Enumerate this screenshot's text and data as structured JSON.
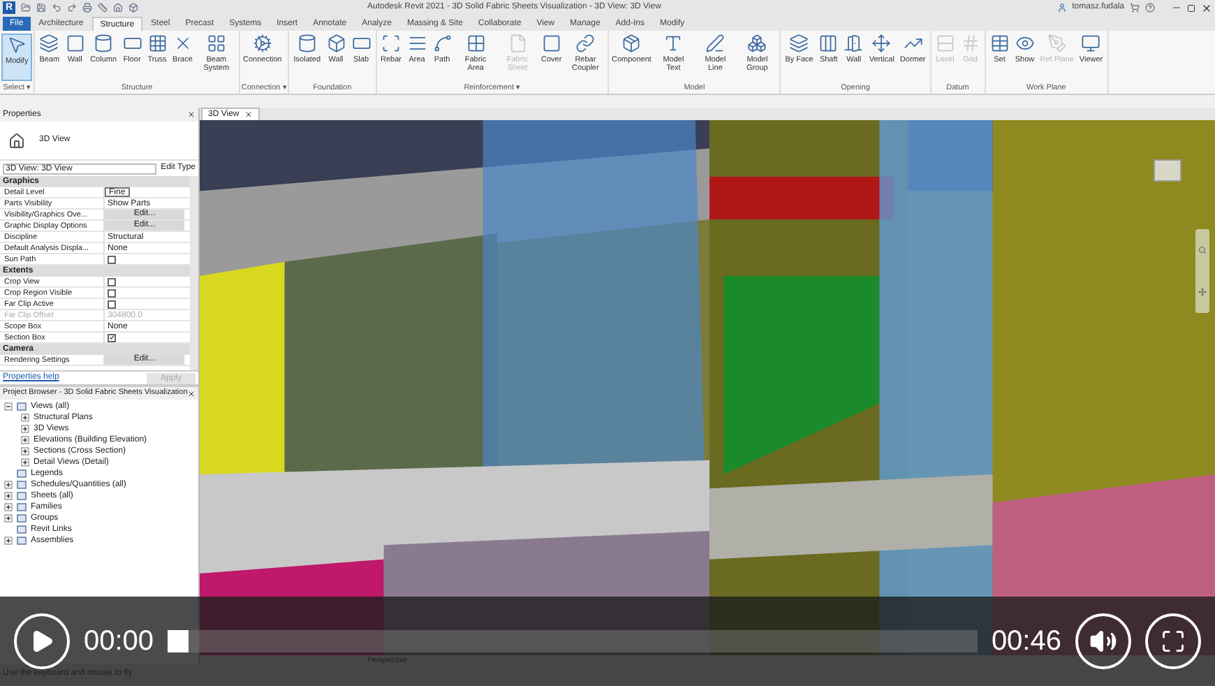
{
  "title_bar": {
    "app_logo": "R",
    "title": "Autodesk Revit 2021 - 3D Solid Fabric Sheets Visualization - 3D View: 3D View",
    "user": "tomasz.fudala"
  },
  "ribbon_tabs": [
    {
      "label": "File",
      "selected": false,
      "kind": "file"
    },
    {
      "label": "Architecture",
      "selected": false,
      "kind": "tab"
    },
    {
      "label": "Structure",
      "selected": true,
      "kind": "tab"
    },
    {
      "label": "Steel",
      "selected": false,
      "kind": "tab"
    },
    {
      "label": "Precast",
      "selected": false,
      "kind": "tab"
    },
    {
      "label": "Systems",
      "selected": false,
      "kind": "tab"
    },
    {
      "label": "Insert",
      "selected": false,
      "kind": "tab"
    },
    {
      "label": "Annotate",
      "selected": false,
      "kind": "tab"
    },
    {
      "label": "Analyze",
      "selected": false,
      "kind": "tab"
    },
    {
      "label": "Massing & Site",
      "selected": false,
      "kind": "tab"
    },
    {
      "label": "Collaborate",
      "selected": false,
      "kind": "tab"
    },
    {
      "label": "View",
      "selected": false,
      "kind": "tab"
    },
    {
      "label": "Manage",
      "selected": false,
      "kind": "tab"
    },
    {
      "label": "Add-Ins",
      "selected": false,
      "kind": "tab"
    },
    {
      "label": "Modify",
      "selected": false,
      "kind": "tab"
    }
  ],
  "ribbon_panels": [
    {
      "title": "Select ▾",
      "tools": [
        {
          "label": "Modify",
          "active": true,
          "disabled": false
        }
      ]
    },
    {
      "title": "Structure",
      "tools": [
        {
          "label": "Beam",
          "active": false,
          "disabled": false
        },
        {
          "label": "Wall",
          "active": false,
          "disabled": false
        },
        {
          "label": "Column",
          "active": false,
          "disabled": false
        },
        {
          "label": "Floor",
          "active": false,
          "disabled": false
        },
        {
          "label": "Truss",
          "active": false,
          "disabled": false
        },
        {
          "label": "Brace",
          "active": false,
          "disabled": false
        },
        {
          "label": "Beam System",
          "active": false,
          "disabled": false
        }
      ]
    },
    {
      "title": "Connection ▾",
      "tools": [
        {
          "label": "Connection",
          "active": false,
          "disabled": false
        }
      ]
    },
    {
      "title": "Foundation",
      "tools": [
        {
          "label": "Isolated",
          "active": false,
          "disabled": false
        },
        {
          "label": "Wall",
          "active": false,
          "disabled": false
        },
        {
          "label": "Slab",
          "active": false,
          "disabled": false
        }
      ]
    },
    {
      "title": "Reinforcement ▾",
      "tools": [
        {
          "label": "Rebar",
          "active": false,
          "disabled": false
        },
        {
          "label": "Area",
          "active": false,
          "disabled": false
        },
        {
          "label": "Path",
          "active": false,
          "disabled": false
        },
        {
          "label": "Fabric Area",
          "active": false,
          "disabled": false
        },
        {
          "label": "Fabric Sheet",
          "active": false,
          "disabled": true
        },
        {
          "label": "Cover",
          "active": false,
          "disabled": false
        },
        {
          "label": "Rebar Coupler",
          "active": false,
          "disabled": false
        }
      ]
    },
    {
      "title": "Model",
      "tools": [
        {
          "label": "Component",
          "active": false,
          "disabled": false
        },
        {
          "label": "Model Text",
          "active": false,
          "disabled": false
        },
        {
          "label": "Model Line",
          "active": false,
          "disabled": false
        },
        {
          "label": "Model Group",
          "active": false,
          "disabled": false
        }
      ]
    },
    {
      "title": "Opening",
      "tools": [
        {
          "label": "By Face",
          "active": false,
          "disabled": false
        },
        {
          "label": "Shaft",
          "active": false,
          "disabled": false
        },
        {
          "label": "Wall",
          "active": false,
          "disabled": false
        },
        {
          "label": "Vertical",
          "active": false,
          "disabled": false
        },
        {
          "label": "Dormer",
          "active": false,
          "disabled": false
        }
      ]
    },
    {
      "title": "Datum",
      "tools": [
        {
          "label": "Level",
          "active": false,
          "disabled": true
        },
        {
          "label": "Grid",
          "active": false,
          "disabled": true
        }
      ]
    },
    {
      "title": "Work Plane",
      "tools": [
        {
          "label": "Set",
          "active": false,
          "disabled": false
        },
        {
          "label": "Show",
          "active": false,
          "disabled": false
        },
        {
          "label": "Ref Plane",
          "active": false,
          "disabled": true
        },
        {
          "label": "Viewer",
          "active": false,
          "disabled": false
        }
      ]
    }
  ],
  "properties": {
    "title": "Properties",
    "type_name": "3D View",
    "selector": "3D View: 3D View",
    "edit_type": "Edit Type",
    "sections": [
      {
        "title": "Graphics",
        "rows": [
          {
            "label": "Detail Level",
            "kind": "field",
            "value": "Fine"
          },
          {
            "label": "Parts Visibility",
            "kind": "text",
            "value": "Show Parts"
          },
          {
            "label": "Visibility/Graphics Ove...",
            "kind": "button",
            "value": "Edit..."
          },
          {
            "label": "Graphic Display Options",
            "kind": "button",
            "value": "Edit..."
          },
          {
            "label": "Discipline",
            "kind": "text",
            "value": "Structural"
          },
          {
            "label": "Default Analysis Displa...",
            "kind": "text",
            "value": "None"
          },
          {
            "label": "Sun Path",
            "kind": "checkbox",
            "checked": false
          }
        ]
      },
      {
        "title": "Extents",
        "rows": [
          {
            "label": "Crop View",
            "kind": "checkbox",
            "checked": false
          },
          {
            "label": "Crop Region Visible",
            "kind": "checkbox",
            "checked": false
          },
          {
            "label": "Far Clip Active",
            "kind": "checkbox",
            "checked": false
          },
          {
            "label": "Far Clip Offset",
            "kind": "disabled",
            "value": "304800.0"
          },
          {
            "label": "Scope Box",
            "kind": "text",
            "value": "None"
          },
          {
            "label": "Section Box",
            "kind": "checkbox",
            "checked": true
          }
        ]
      },
      {
        "title": "Camera",
        "rows": [
          {
            "label": "Rendering Settings",
            "kind": "button",
            "value": "Edit..."
          }
        ]
      }
    ],
    "help_link": "Properties help",
    "apply": "Apply"
  },
  "project_browser": {
    "title": "Project Browser - 3D Solid Fabric Sheets Visualization",
    "items": [
      {
        "label": "Views (all)",
        "expanded": true,
        "children": [
          {
            "label": "Structural Plans",
            "expanded": false
          },
          {
            "label": "3D Views",
            "expanded": false
          },
          {
            "label": "Elevations (Building Elevation)",
            "expanded": false
          },
          {
            "label": "Sections (Cross Section)",
            "expanded": false
          },
          {
            "label": "Detail Views (Detail)",
            "expanded": false
          }
        ]
      },
      {
        "label": "Legends"
      },
      {
        "label": "Schedules/Quantities (all)",
        "expanded": false
      },
      {
        "label": "Sheets (all)",
        "expanded": false
      },
      {
        "label": "Families",
        "expanded": false
      },
      {
        "label": "Groups",
        "expanded": false
      },
      {
        "label": "Revit Links"
      },
      {
        "label": "Assemblies",
        "expanded": false
      }
    ]
  },
  "view_tab": {
    "label": "3D View"
  },
  "view_control_bar": {
    "label": "Perspective"
  },
  "status_bar": {
    "text": "Use the keyboard and mouse to fly"
  },
  "video_player": {
    "current_time": "00:00",
    "duration": "00:46",
    "progress": {
      "level": 0
    }
  }
}
